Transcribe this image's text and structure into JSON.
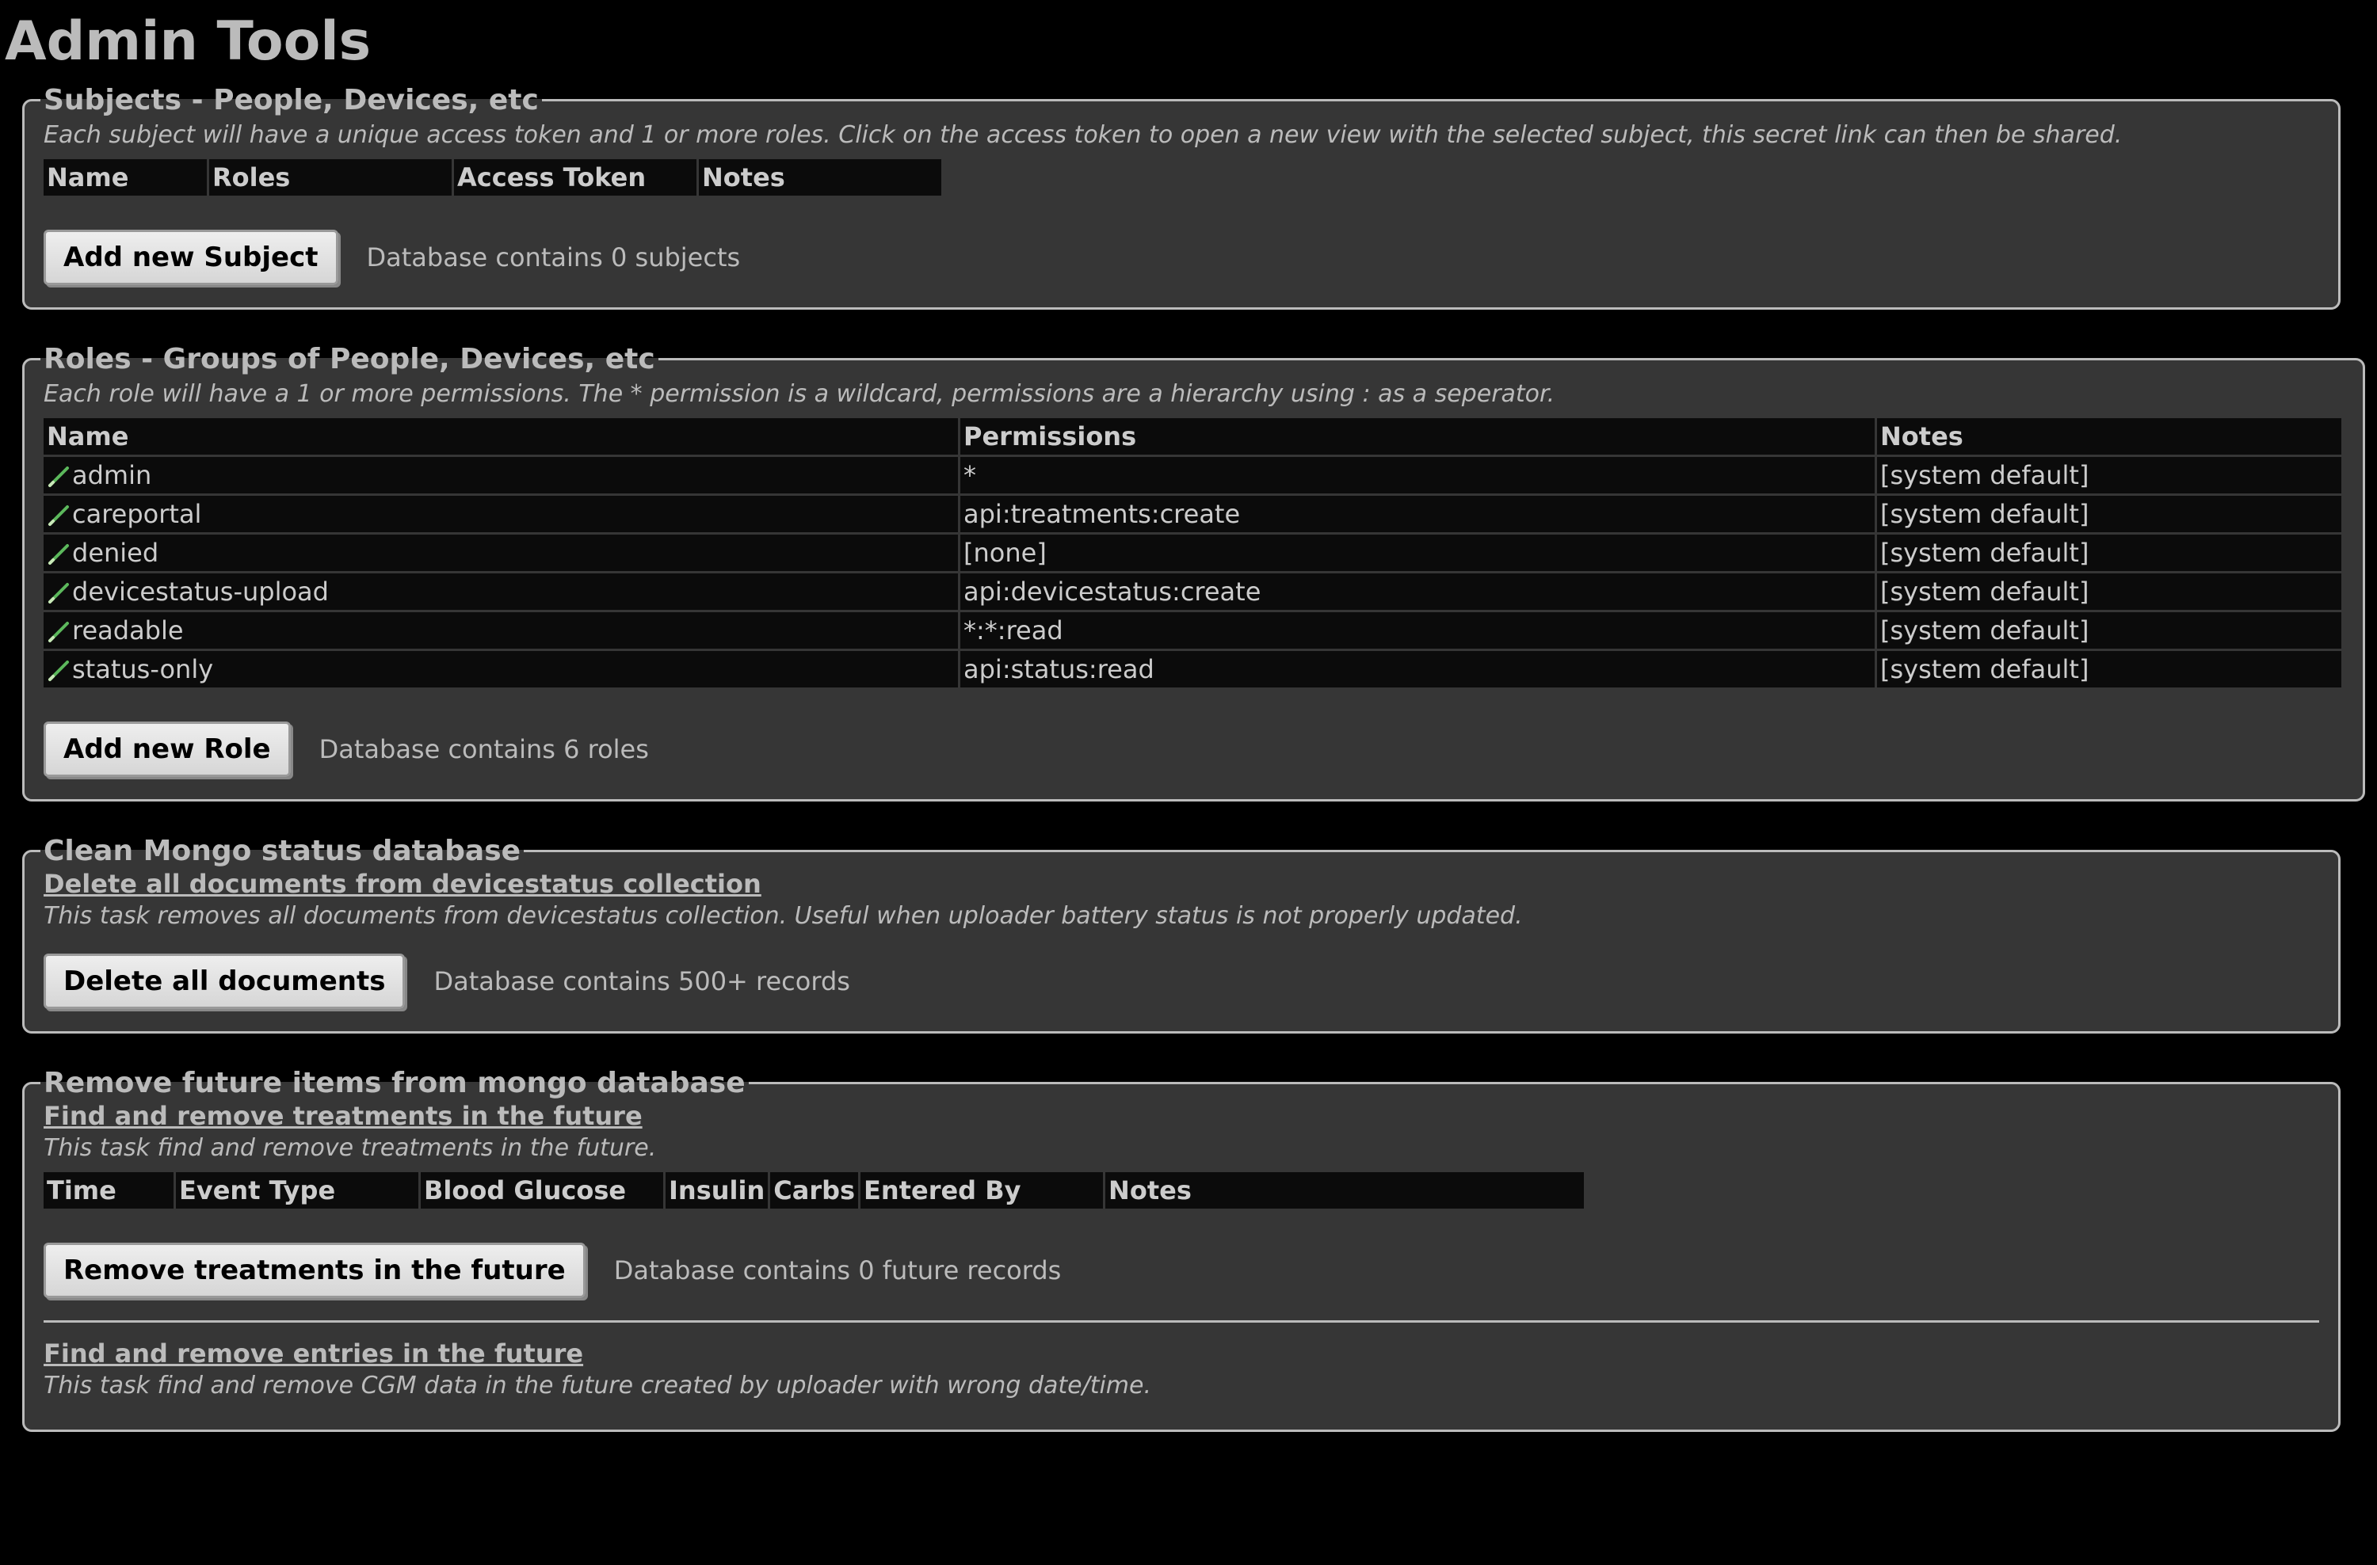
{
  "page_title": "Admin Tools",
  "subjects": {
    "legend": "Subjects - People, Devices, etc",
    "description": "Each subject will have a unique access token and 1 or more roles.  Click on the access token to open a new view with the selected subject, this secret link can then be shared.",
    "columns": [
      "Name",
      "Roles",
      "Access Token",
      "Notes"
    ],
    "add_button": "Add new Subject",
    "count_text": "Database contains 0 subjects"
  },
  "roles": {
    "legend": "Roles - Groups of People, Devices, etc",
    "description": "Each role will have a 1 or more permissions.  The * permission is a wildcard, permissions are a hierarchy using : as a seperator.",
    "columns": [
      "Name",
      "Permissions",
      "Notes"
    ],
    "rows": [
      {
        "name": "admin",
        "permissions": "*",
        "notes": "[system default]"
      },
      {
        "name": "careportal",
        "permissions": "api:treatments:create",
        "notes": "[system default]"
      },
      {
        "name": "denied",
        "permissions": "[none]",
        "notes": "[system default]"
      },
      {
        "name": "devicestatus-upload",
        "permissions": "api:devicestatus:create",
        "notes": "[system default]"
      },
      {
        "name": "readable",
        "permissions": "*:*:read",
        "notes": "[system default]"
      },
      {
        "name": "status-only",
        "permissions": "api:status:read",
        "notes": "[system default]"
      }
    ],
    "add_button": "Add new Role",
    "count_text": "Database contains 6 roles",
    "edit_icon": "pencil-icon",
    "edit_icon_color": "#5cb85c"
  },
  "clean_mongo": {
    "legend": "Clean Mongo status database",
    "task_link": "Delete all documents from devicestatus collection",
    "description": "This task removes all documents from devicestatus collection. Useful when uploader battery status is not properly updated.",
    "button": "Delete all documents",
    "count_text": "Database contains 500+ records"
  },
  "future_items": {
    "legend": "Remove future items from mongo database",
    "treatments": {
      "task_link": "Find and remove treatments in the future",
      "description": "This task find and remove treatments in the future.",
      "columns": [
        "Time",
        "Event Type",
        "Blood Glucose",
        "Insulin",
        "Carbs",
        "Entered By",
        "Notes"
      ],
      "button": "Remove treatments in the future",
      "count_text": "Database contains 0 future records"
    },
    "entries": {
      "task_link": "Find and remove entries in the future",
      "description": "This task find and remove CGM data in the future created by uploader with wrong date/time."
    }
  }
}
